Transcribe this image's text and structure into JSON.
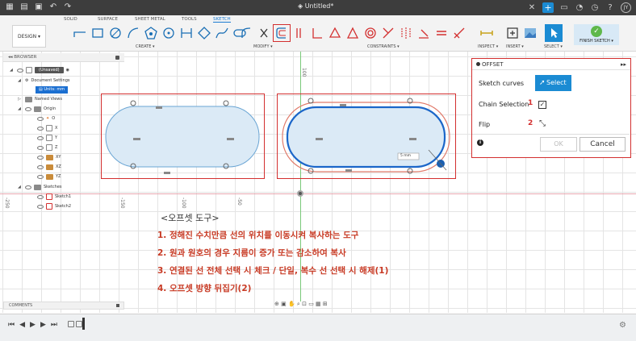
{
  "window": {
    "title": "Untitled*"
  },
  "ribbon": {
    "tabs": [
      "SOLID",
      "SURFACE",
      "SHEET METAL",
      "TOOLS",
      "SKETCH"
    ],
    "active_tab": "SKETCH",
    "workspace": "DESIGN ▾",
    "groups": [
      "CREATE ▾",
      "MODIFY ▾",
      "CONSTRAINTS ▾",
      "INSPECT ▾",
      "INSERT ▾",
      "SELECT ▾",
      "FINISH SKETCH ▾"
    ]
  },
  "browser": {
    "header": "BROWSER",
    "items": {
      "root": "(Unsaved)",
      "doc_settings": "Document Settings",
      "units": "Units: mm",
      "named_views": "Named Views",
      "origin": "Origin",
      "o": "O",
      "x": "X",
      "y": "Y",
      "z": "Z",
      "xy": "XY",
      "xz": "XZ",
      "yz": "YZ",
      "sketches": "Sketches",
      "sketch1": "Sketch1",
      "sketch2": "Sketch2"
    }
  },
  "canvas": {
    "ruler_labels": [
      "100",
      "-250",
      "-150",
      "-100",
      "-50"
    ],
    "dimension_value": "5 mm"
  },
  "offset_panel": {
    "title": "OFFSET",
    "sketch_curves_label": "Sketch curves",
    "select_label": "Select",
    "chain_selection_label": "Chain Selection",
    "chain_selection_checked": true,
    "flip_label": "Flip",
    "callout_1": "1",
    "callout_2": "2",
    "ok_label": "OK",
    "cancel_label": "Cancel"
  },
  "notes": {
    "title": "<오프셋 도구>",
    "lines": [
      "1.  정해진 수치만큼 선의 위치를 이동시켜 복사하는 도구",
      "2.  원과 원호의 경우 지름이 증가 또는 감소하여 복사",
      "3.  연결된 선 전체 선택 시 체크 / 단일, 복수 선 선택 시 해제(1)",
      "4.  오프셋 방향 뒤집기(2)"
    ]
  },
  "comments": {
    "label": "COMMENTS"
  },
  "colors": {
    "accent": "#1b8bd3",
    "annotation_red": "#d32f2f",
    "note_text": "#c83a24"
  }
}
